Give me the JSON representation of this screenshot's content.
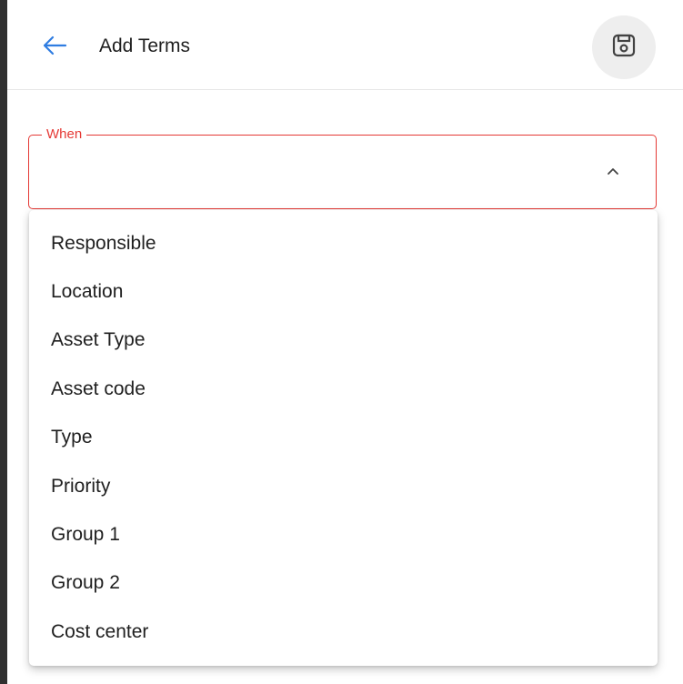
{
  "header": {
    "title": "Add Terms",
    "back_icon": "arrow-left-icon",
    "save_icon": "floppy-disk-icon"
  },
  "form": {
    "when_field": {
      "label": "When",
      "value": "",
      "state": "error-expanded"
    }
  },
  "dropdown": {
    "items": [
      {
        "label": "Responsible"
      },
      {
        "label": "Location"
      },
      {
        "label": "Asset Type"
      },
      {
        "label": "Asset code"
      },
      {
        "label": "Type"
      },
      {
        "label": "Priority"
      },
      {
        "label": "Group 1"
      },
      {
        "label": "Group 2"
      },
      {
        "label": "Cost center"
      }
    ]
  },
  "colors": {
    "accent": "#1976d2",
    "error": "#e53935",
    "header_button_bg": "#eeeeee",
    "left_strip": "#303030"
  }
}
